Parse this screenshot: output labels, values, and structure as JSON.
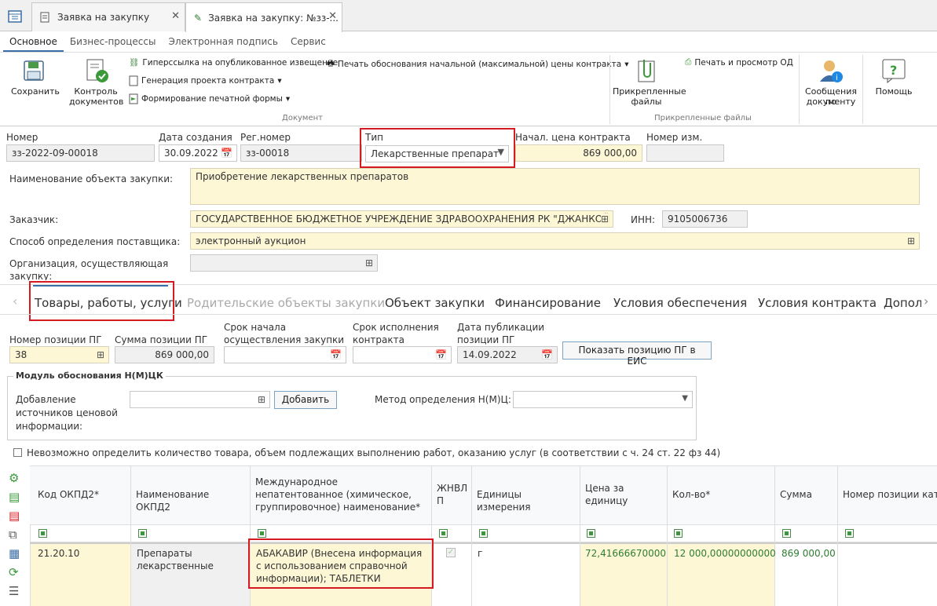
{
  "tabs": [
    {
      "label": "Заявка на закупку"
    },
    {
      "label": "Заявка на закупку: №зз-..."
    }
  ],
  "menu": [
    "Основное",
    "Бизнес-процессы",
    "Электронная подпись",
    "Сервис"
  ],
  "ribbon": {
    "save": "Сохранить",
    "control_l1": "Контроль",
    "control_l2": "документов",
    "hyperlink": "Гиперссылка на опубликованное извещение",
    "gen_contract": "Генерация проекта контракта",
    "print_form": "Формирование печатной формы",
    "print_justification": "Печать обоснования начальной (максимальной) цены контракта",
    "print_od": "Печать и просмотр ОД",
    "attached_l1": "Прикрепленные",
    "attached_l2": "файлы",
    "messages_l1": "Сообщения по",
    "messages_l2": "документу",
    "help": "Помощь",
    "group_document": "Документ",
    "group_files": "Прикрепленные файлы"
  },
  "form": {
    "number_label": "Номер",
    "number": "зз-2022-09-00018",
    "date_label": "Дата создания",
    "date": "30.09.2022",
    "regnum_label": "Рег.номер",
    "regnum": "зз-00018",
    "type_label": "Тип",
    "type": "Лекарственные препарат",
    "price_label": "Начал. цена контракта",
    "price": "869 000,00",
    "change_label": "Номер изм.",
    "change": "",
    "object_label": "Наименование объекта закупки:",
    "object": "Приобретение лекарственных препаратов",
    "customer_label": "Заказчик:",
    "customer": "ГОСУДАРСТВЕННОЕ БЮДЖЕТНОЕ УЧРЕЖДЕНИЕ ЗДРАВООХРАНЕНИЯ РК \"ДЖАНКОЙ",
    "inn_label": "ИНН:",
    "inn": "9105006736",
    "method_label": "Способ определения поставщика:",
    "method": "электронный аукцион",
    "org_label_l1": "Организация, осуществляющая",
    "org_label_l2": "закупку:",
    "org": ""
  },
  "section_tabs": [
    "Товары, работы, услуги",
    "Родительские объекты закупки",
    "Объект закупки",
    "Финансирование",
    "Условия обеспечения",
    "Условия контракта",
    "Допол"
  ],
  "position": {
    "pos_label": "Номер позиции ПГ",
    "pos": "38",
    "sum_label": "Сумма позиции ПГ",
    "sum": "869 000,00",
    "start_l1": "Срок начала",
    "start_l2": "осуществления закупки",
    "start": "",
    "exec_l1": "Срок исполнения",
    "exec_l2": "контракта",
    "exec": "",
    "pub_l1": "Дата публикации",
    "pub_l2": "позиции ПГ",
    "pub": "14.09.2022",
    "show_btn": "Показать позицию ПГ в ЕИС"
  },
  "module": {
    "title": "Модуль обоснования Н(М)ЦК",
    "src_l1": "Добавление",
    "src_l2": "источников ценовой",
    "src_l3": "информации:",
    "add_btn": "Добавить",
    "method_label": "Метод определения Н(М)Ц:",
    "method": ""
  },
  "checkbox_label": "Невозможно определить количество товара, объем подлежащих выполнению работ, оказанию услуг (в соответствии с ч. 24 ст. 22 фз 44)",
  "table": {
    "headers": [
      "Код ОКПД2*",
      "Наименование ОКПД2",
      "Международное непатентованное (химическое, группировочное) наименование*",
      "ЖНВЛП",
      "Единицы измерения",
      "Цена за единицу",
      "Кол-во*",
      "Сумма",
      "Номер позиции ката"
    ],
    "rows": [
      [
        "21.20.10",
        "Препараты лекарственные",
        "АБАКАВИР (Внесена информация с использованием справочной информации); ТАБЛЕТКИ",
        "",
        "г",
        "72,41666670000",
        "12 000,00000000000",
        "869 000,00",
        ""
      ]
    ]
  },
  "colors": {
    "highlight": "#d51a22",
    "yellow": "#fdf7d6",
    "green": "#2e7d32"
  }
}
